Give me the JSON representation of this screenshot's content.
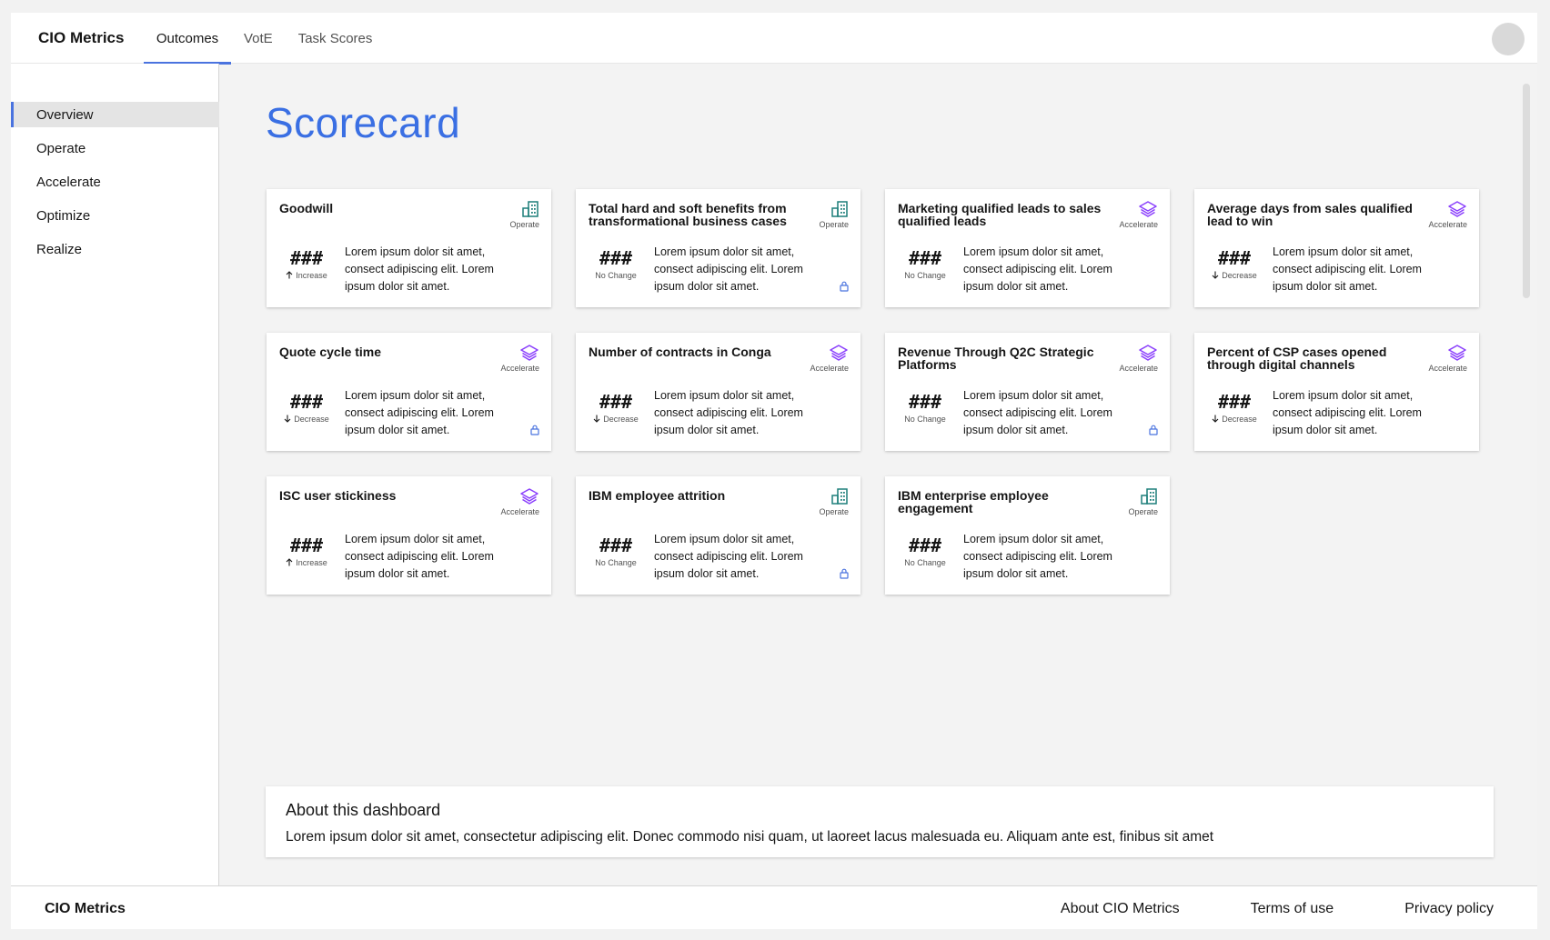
{
  "header": {
    "brand": "CIO Metrics",
    "tabs": [
      {
        "label": "Outcomes",
        "active": true
      },
      {
        "label": "VotE",
        "active": false
      },
      {
        "label": "Task Scores",
        "active": false
      }
    ]
  },
  "sidebar": {
    "items": [
      {
        "label": "Overview",
        "active": true
      },
      {
        "label": "Operate",
        "active": false
      },
      {
        "label": "Accelerate",
        "active": false
      },
      {
        "label": "Optimize",
        "active": false
      },
      {
        "label": "Realize",
        "active": false
      }
    ]
  },
  "main": {
    "title": "Scorecard",
    "cards": [
      {
        "title": "Goodwill",
        "category": "Operate",
        "category_icon": "building-icon",
        "value": "###",
        "trend": "Increase",
        "trend_icon": "arrow-up-icon",
        "description": "Lorem ipsum dolor sit amet, consect adipiscing elit. Lorem ipsum dolor sit amet.",
        "locked": false
      },
      {
        "title": "Total hard and soft benefits from transformational business cases",
        "category": "Operate",
        "category_icon": "building-icon",
        "value": "###",
        "trend": "No Change",
        "trend_icon": "",
        "description": "Lorem ipsum dolor sit amet, consect adipiscing elit. Lorem ipsum dolor sit amet.",
        "locked": true
      },
      {
        "title": "Marketing qualified leads to sales qualified leads",
        "category": "Accelerate",
        "category_icon": "layers-icon",
        "value": "###",
        "trend": "No Change",
        "trend_icon": "",
        "description": "Lorem ipsum dolor sit amet, consect adipiscing elit. Lorem ipsum dolor sit amet.",
        "locked": false
      },
      {
        "title": "Average days from sales qualified lead to win",
        "category": "Accelerate",
        "category_icon": "layers-icon",
        "value": "###",
        "trend": "Decrease",
        "trend_icon": "arrow-down-icon",
        "description": "Lorem ipsum dolor sit amet, consect adipiscing elit. Lorem ipsum dolor sit amet.",
        "locked": false
      },
      {
        "title": "Quote cycle time",
        "category": "Accelerate",
        "category_icon": "layers-icon",
        "value": "###",
        "trend": "Decrease",
        "trend_icon": "arrow-down-icon",
        "description": "Lorem ipsum dolor sit amet, consect adipiscing elit. Lorem ipsum dolor sit amet.",
        "locked": true
      },
      {
        "title": "Number of contracts in Conga",
        "category": "Accelerate",
        "category_icon": "layers-icon",
        "value": "###",
        "trend": "Decrease",
        "trend_icon": "arrow-down-icon",
        "description": "Lorem ipsum dolor sit amet, consect adipiscing elit. Lorem ipsum dolor sit amet.",
        "locked": false
      },
      {
        "title": "Revenue Through Q2C Strategic Platforms",
        "category": "Accelerate",
        "category_icon": "layers-icon",
        "value": "###",
        "trend": "No Change",
        "trend_icon": "",
        "description": "Lorem ipsum dolor sit amet, consect adipiscing elit. Lorem ipsum dolor sit amet.",
        "locked": true
      },
      {
        "title": "Percent of CSP cases opened through digital channels",
        "category": "Accelerate",
        "category_icon": "layers-icon",
        "value": "###",
        "trend": "Decrease",
        "trend_icon": "arrow-down-icon",
        "description": "Lorem ipsum dolor sit amet, consect adipiscing elit. Lorem ipsum dolor sit amet.",
        "locked": false
      },
      {
        "title": "ISC user stickiness",
        "category": "Accelerate",
        "category_icon": "layers-icon",
        "value": "###",
        "trend": "Increase",
        "trend_icon": "arrow-up-icon",
        "description": "Lorem ipsum dolor sit amet, consect adipiscing elit. Lorem ipsum dolor sit amet.",
        "locked": false
      },
      {
        "title": "IBM employee attrition",
        "category": "Operate",
        "category_icon": "building-icon",
        "value": "###",
        "trend": "No Change",
        "trend_icon": "",
        "description": "Lorem ipsum dolor sit amet, consect adipiscing elit. Lorem ipsum dolor sit amet.",
        "locked": true
      },
      {
        "title": "IBM enterprise employee engagement",
        "category": "Operate",
        "category_icon": "building-icon",
        "value": "###",
        "trend": "No Change",
        "trend_icon": "",
        "description": "Lorem ipsum dolor sit amet, consect adipiscing elit. Lorem ipsum dolor sit amet.",
        "locked": false
      }
    ],
    "about": {
      "title": "About this dashboard",
      "text": "Lorem ipsum dolor sit amet, consectetur adipiscing elit. Donec commodo nisi quam, ut laoreet lacus malesuada eu. Aliquam ante est, finibus sit amet"
    }
  },
  "footer": {
    "brand": "CIO Metrics",
    "links": [
      "About CIO Metrics",
      "Terms of use",
      "Privacy policy"
    ]
  },
  "colors": {
    "accent": "#4a73df",
    "title_blue": "#3a6fe3",
    "operate_teal": "#1d7f7a",
    "accelerate_purple": "#8a3ffc"
  }
}
